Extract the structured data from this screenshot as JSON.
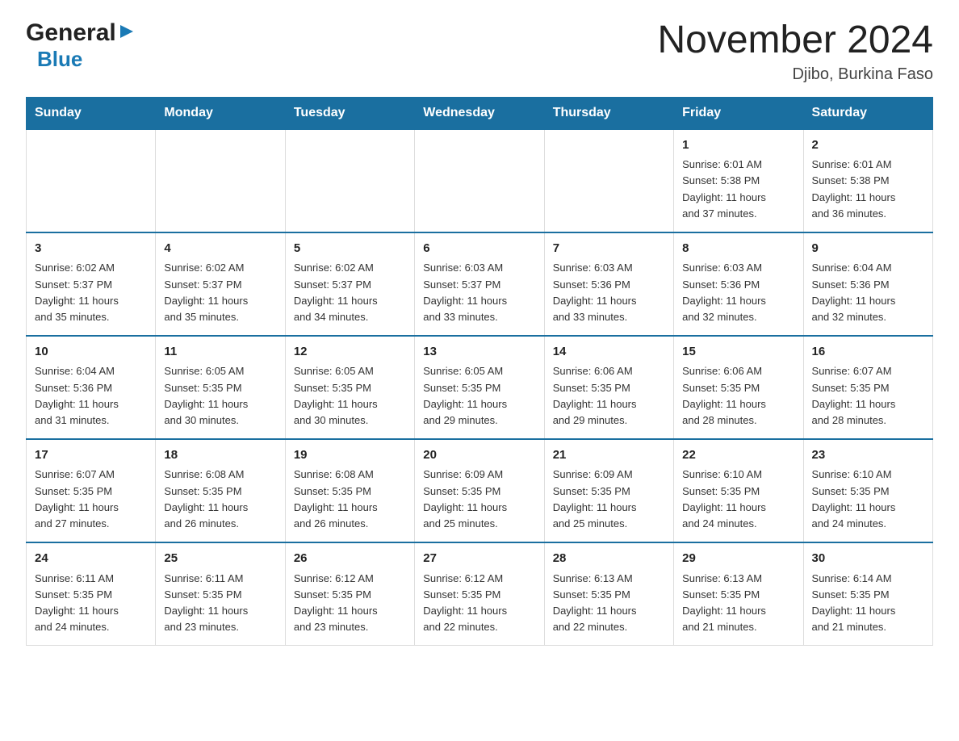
{
  "header": {
    "logo_general": "General",
    "logo_blue": "Blue",
    "month_title": "November 2024",
    "location": "Djibo, Burkina Faso"
  },
  "weekdays": [
    "Sunday",
    "Monday",
    "Tuesday",
    "Wednesday",
    "Thursday",
    "Friday",
    "Saturday"
  ],
  "weeks": [
    [
      {
        "day": "",
        "info": ""
      },
      {
        "day": "",
        "info": ""
      },
      {
        "day": "",
        "info": ""
      },
      {
        "day": "",
        "info": ""
      },
      {
        "day": "",
        "info": ""
      },
      {
        "day": "1",
        "info": "Sunrise: 6:01 AM\nSunset: 5:38 PM\nDaylight: 11 hours\nand 37 minutes."
      },
      {
        "day": "2",
        "info": "Sunrise: 6:01 AM\nSunset: 5:38 PM\nDaylight: 11 hours\nand 36 minutes."
      }
    ],
    [
      {
        "day": "3",
        "info": "Sunrise: 6:02 AM\nSunset: 5:37 PM\nDaylight: 11 hours\nand 35 minutes."
      },
      {
        "day": "4",
        "info": "Sunrise: 6:02 AM\nSunset: 5:37 PM\nDaylight: 11 hours\nand 35 minutes."
      },
      {
        "day": "5",
        "info": "Sunrise: 6:02 AM\nSunset: 5:37 PM\nDaylight: 11 hours\nand 34 minutes."
      },
      {
        "day": "6",
        "info": "Sunrise: 6:03 AM\nSunset: 5:37 PM\nDaylight: 11 hours\nand 33 minutes."
      },
      {
        "day": "7",
        "info": "Sunrise: 6:03 AM\nSunset: 5:36 PM\nDaylight: 11 hours\nand 33 minutes."
      },
      {
        "day": "8",
        "info": "Sunrise: 6:03 AM\nSunset: 5:36 PM\nDaylight: 11 hours\nand 32 minutes."
      },
      {
        "day": "9",
        "info": "Sunrise: 6:04 AM\nSunset: 5:36 PM\nDaylight: 11 hours\nand 32 minutes."
      }
    ],
    [
      {
        "day": "10",
        "info": "Sunrise: 6:04 AM\nSunset: 5:36 PM\nDaylight: 11 hours\nand 31 minutes."
      },
      {
        "day": "11",
        "info": "Sunrise: 6:05 AM\nSunset: 5:35 PM\nDaylight: 11 hours\nand 30 minutes."
      },
      {
        "day": "12",
        "info": "Sunrise: 6:05 AM\nSunset: 5:35 PM\nDaylight: 11 hours\nand 30 minutes."
      },
      {
        "day": "13",
        "info": "Sunrise: 6:05 AM\nSunset: 5:35 PM\nDaylight: 11 hours\nand 29 minutes."
      },
      {
        "day": "14",
        "info": "Sunrise: 6:06 AM\nSunset: 5:35 PM\nDaylight: 11 hours\nand 29 minutes."
      },
      {
        "day": "15",
        "info": "Sunrise: 6:06 AM\nSunset: 5:35 PM\nDaylight: 11 hours\nand 28 minutes."
      },
      {
        "day": "16",
        "info": "Sunrise: 6:07 AM\nSunset: 5:35 PM\nDaylight: 11 hours\nand 28 minutes."
      }
    ],
    [
      {
        "day": "17",
        "info": "Sunrise: 6:07 AM\nSunset: 5:35 PM\nDaylight: 11 hours\nand 27 minutes."
      },
      {
        "day": "18",
        "info": "Sunrise: 6:08 AM\nSunset: 5:35 PM\nDaylight: 11 hours\nand 26 minutes."
      },
      {
        "day": "19",
        "info": "Sunrise: 6:08 AM\nSunset: 5:35 PM\nDaylight: 11 hours\nand 26 minutes."
      },
      {
        "day": "20",
        "info": "Sunrise: 6:09 AM\nSunset: 5:35 PM\nDaylight: 11 hours\nand 25 minutes."
      },
      {
        "day": "21",
        "info": "Sunrise: 6:09 AM\nSunset: 5:35 PM\nDaylight: 11 hours\nand 25 minutes."
      },
      {
        "day": "22",
        "info": "Sunrise: 6:10 AM\nSunset: 5:35 PM\nDaylight: 11 hours\nand 24 minutes."
      },
      {
        "day": "23",
        "info": "Sunrise: 6:10 AM\nSunset: 5:35 PM\nDaylight: 11 hours\nand 24 minutes."
      }
    ],
    [
      {
        "day": "24",
        "info": "Sunrise: 6:11 AM\nSunset: 5:35 PM\nDaylight: 11 hours\nand 24 minutes."
      },
      {
        "day": "25",
        "info": "Sunrise: 6:11 AM\nSunset: 5:35 PM\nDaylight: 11 hours\nand 23 minutes."
      },
      {
        "day": "26",
        "info": "Sunrise: 6:12 AM\nSunset: 5:35 PM\nDaylight: 11 hours\nand 23 minutes."
      },
      {
        "day": "27",
        "info": "Sunrise: 6:12 AM\nSunset: 5:35 PM\nDaylight: 11 hours\nand 22 minutes."
      },
      {
        "day": "28",
        "info": "Sunrise: 6:13 AM\nSunset: 5:35 PM\nDaylight: 11 hours\nand 22 minutes."
      },
      {
        "day": "29",
        "info": "Sunrise: 6:13 AM\nSunset: 5:35 PM\nDaylight: 11 hours\nand 21 minutes."
      },
      {
        "day": "30",
        "info": "Sunrise: 6:14 AM\nSunset: 5:35 PM\nDaylight: 11 hours\nand 21 minutes."
      }
    ]
  ]
}
